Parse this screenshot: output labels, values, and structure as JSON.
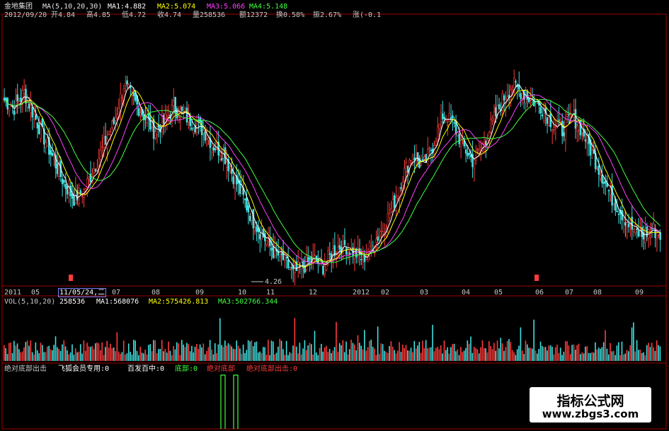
{
  "info": {
    "stock_name": "金地集团",
    "ma_label": "MA(5,10,20,30)",
    "ma1": "MA1:4.882",
    "ma2": "MA2:5.074",
    "ma3": "MA3:5.066",
    "ma4": "MA4:5.148",
    "date": "2012/09/20",
    "open": "开4.84",
    "high": "高4.85",
    "low": "低4.72",
    "close": "收4.74",
    "volume": "量258536",
    "amount": "额12372",
    "turnover": "换0.58%",
    "amplitude": "振2.67%",
    "change": "涨(-0.1"
  },
  "timeline": {
    "labels": [
      "2011",
      "05",
      "07",
      "08",
      "09",
      "10",
      "11",
      "12",
      "2012",
      "02",
      "03",
      "04",
      "05",
      "06",
      "07",
      "08",
      "09"
    ],
    "highlight": "11/05/24,二"
  },
  "price_annotation": "4.26",
  "vol_panel": {
    "label": "VOL(5,10,20)",
    "value": "258536",
    "ma1": "MA1:568076",
    "ma2": "MA2:575426.813",
    "ma3": "MA3:502766.344"
  },
  "indicator": {
    "name": "绝对底部出击",
    "item1": "飞狐会员专用:0",
    "item2": "百发百中:0",
    "item3": "底部:0",
    "item4": "绝对底部",
    "item5": "绝对底部出击:0"
  },
  "watermark": {
    "title": "指标公式网",
    "url": "www.zbgs3.com"
  },
  "colors": {
    "up": "#ff3b3b",
    "down": "#40e0e0",
    "ma1": "#ffffff",
    "ma2": "#ffff00",
    "ma3": "#ff40ff",
    "ma4": "#40ff40",
    "frame": "#a00000"
  },
  "chart_data": {
    "type": "candlestick",
    "title": "金地集团",
    "price_low_label": 4.26,
    "series_close": [
      6.6,
      6.5,
      6.7,
      6.4,
      6.1,
      5.8,
      5.5,
      5.3,
      5.4,
      5.7,
      6.0,
      6.3,
      6.8,
      6.6,
      6.4,
      6.2,
      6.3,
      6.5,
      6.4,
      6.3,
      6.2,
      6.0,
      5.9,
      5.6,
      5.3,
      5.0,
      4.8,
      4.6,
      4.5,
      4.3,
      4.4,
      4.5,
      4.4,
      4.6,
      4.7,
      4.6,
      4.5,
      4.7,
      4.9,
      5.2,
      5.6,
      5.9,
      5.7,
      6.0,
      6.4,
      6.3,
      6.0,
      5.8,
      6.0,
      6.3,
      6.6,
      6.8,
      6.7,
      6.6,
      6.5,
      6.3,
      6.2,
      6.4,
      6.2,
      5.9,
      5.6,
      5.3,
      5.1,
      4.9,
      4.8,
      4.9,
      4.8
    ]
  }
}
